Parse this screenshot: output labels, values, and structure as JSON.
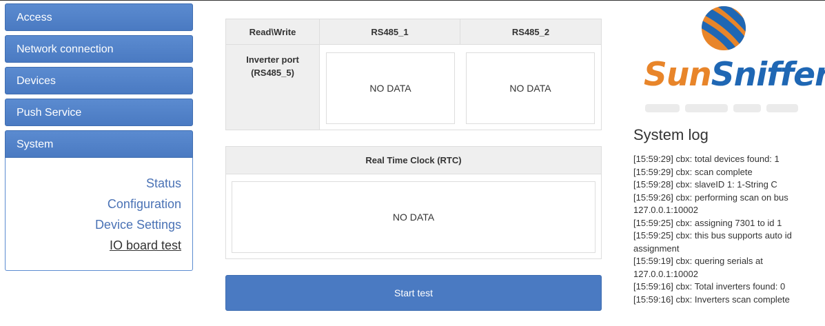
{
  "sidebar": {
    "items": [
      {
        "label": "Access"
      },
      {
        "label": "Network connection"
      },
      {
        "label": "Devices"
      },
      {
        "label": "Push Service"
      },
      {
        "label": "System"
      }
    ],
    "submenu": [
      {
        "label": "Status"
      },
      {
        "label": "Configuration"
      },
      {
        "label": "Device Settings"
      },
      {
        "label": "IO board test"
      }
    ]
  },
  "ports_table": {
    "headers": [
      "Read\\Write",
      "RS485_1",
      "RS485_2"
    ],
    "row_label_line1": "Inverter port",
    "row_label_line2": "(RS485_5)",
    "cell1": "NO DATA",
    "cell2": "NO DATA"
  },
  "rtc": {
    "title": "Real Time Clock (RTC)",
    "value": "NO DATA"
  },
  "start_button": "Start test",
  "logo": {
    "part1": "Sun",
    "part2": "Sniffer",
    "mark": "®"
  },
  "colors": {
    "nav_blue": "#4a7ac2",
    "link_blue": "#4a72b5",
    "logo_orange": "#e8852a",
    "logo_blue": "#1f67b4"
  },
  "system_log": {
    "title": "System log",
    "lines": [
      "[15:59:29] cbx: total devices found: 1",
      "[15:59:29] cbx: scan complete",
      "[15:59:28] cbx: slaveID 1: 1-String C",
      "[15:59:26] cbx: performing scan on bus",
      "127.0.0.1:10002",
      "[15:59:25] cbx: assigning 7301 to id 1",
      "[15:59:25] cbx: this bus supports auto id",
      "assignment",
      "[15:59:19] cbx: quering serials at",
      "127.0.0.1:10002",
      "[15:59:16] cbx: Total inverters found: 0",
      "[15:59:16] cbx: Inverters scan complete"
    ]
  }
}
